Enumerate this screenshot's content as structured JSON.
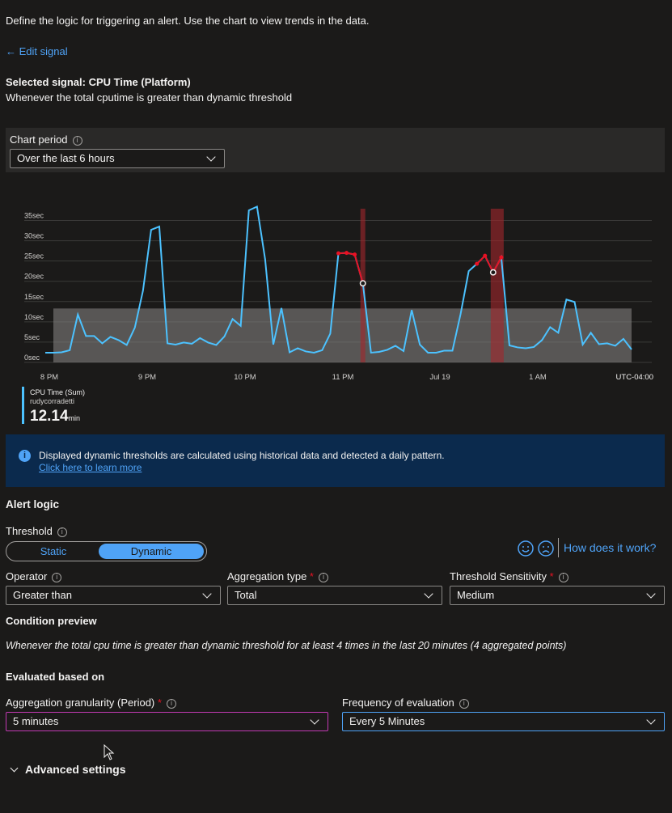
{
  "intro": "Define the logic for triggering an alert. Use the chart to view trends in the data.",
  "edit_signal": "← Edit signal",
  "signal": {
    "title": "Selected signal: CPU Time (Platform)",
    "description": "Whenever the total cputime is greater than dynamic threshold"
  },
  "chart_period": {
    "label": "Chart period",
    "value": "Over the last 6 hours"
  },
  "chart_data": {
    "type": "line",
    "x_ticks": [
      "8 PM",
      "9 PM",
      "10 PM",
      "11 PM",
      "Jul 19",
      "1 AM"
    ],
    "timezone": "UTC-04:00",
    "y_ticks": [
      "0sec",
      "5sec",
      "10sec",
      "15sec",
      "20sec",
      "25sec",
      "30sec",
      "35sec"
    ],
    "ylim": [
      0,
      35
    ],
    "threshold_band": [
      0,
      13.3
    ],
    "series": [
      {
        "name": "CPU Time (Sum)",
        "color": "#4cc2ff",
        "values": [
          2.4,
          2.4,
          2.5,
          3.0,
          11.8,
          6.5,
          6.5,
          4.7,
          6.3,
          5.5,
          4.3,
          8.6,
          17.7,
          32.7,
          33.5,
          4.7,
          4.4,
          4.9,
          4.6,
          6.0,
          4.9,
          4.3,
          6.4,
          10.7,
          9.0,
          37.5,
          38.4,
          25.4,
          4.4,
          13.4,
          2.5,
          3.5,
          2.7,
          2.4,
          3.0,
          7.1,
          26.9,
          27.0,
          26.6,
          19.5,
          2.4,
          2.6,
          3.1,
          4.1,
          2.8,
          12.9,
          4.4,
          2.4,
          2.4,
          2.9,
          2.9,
          11.9,
          22.5,
          24.3,
          26.3,
          22.2,
          25.9,
          4.2,
          3.7,
          3.5,
          3.8,
          5.5,
          8.7,
          7.3,
          15.5,
          14.9,
          4.4,
          7.3,
          4.5,
          4.7,
          4.1,
          5.8,
          3.2
        ]
      }
    ],
    "anomaly_points": [
      36,
      37,
      38,
      53,
      54,
      56
    ],
    "anomaly_breach_points": [
      39,
      55
    ],
    "anomaly_bands": [
      [
        39,
        39
      ],
      [
        55,
        56
      ]
    ]
  },
  "legend": {
    "name": "CPU Time (Sum)",
    "resource": "rudycorradetti",
    "value": "12.14",
    "unit": "min"
  },
  "infobar": {
    "text": "Displayed dynamic thresholds are calculated using historical data and detected a daily pattern.",
    "link": "Click here to learn more"
  },
  "alert_logic": {
    "heading": "Alert logic",
    "threshold_label": "Threshold",
    "threshold_options": [
      "Static",
      "Dynamic"
    ],
    "threshold_selected": "Dynamic",
    "how_link": "How does it work?",
    "operator_label": "Operator",
    "operator_value": "Greater than",
    "aggregation_label": "Aggregation type",
    "aggregation_value": "Total",
    "sensitivity_label": "Threshold Sensitivity",
    "sensitivity_value": "Medium",
    "required_mark": "*"
  },
  "condition": {
    "heading": "Condition preview",
    "text": "Whenever the total cpu time is greater than dynamic threshold for at least 4 times in the last 20 minutes (4 aggregated points)"
  },
  "evaluated": {
    "heading": "Evaluated based on",
    "granularity_label": "Aggregation granularity (Period)",
    "granularity_value": "5 minutes",
    "frequency_label": "Frequency of evaluation",
    "frequency_value": "Every 5 Minutes"
  },
  "advanced": "Advanced settings"
}
